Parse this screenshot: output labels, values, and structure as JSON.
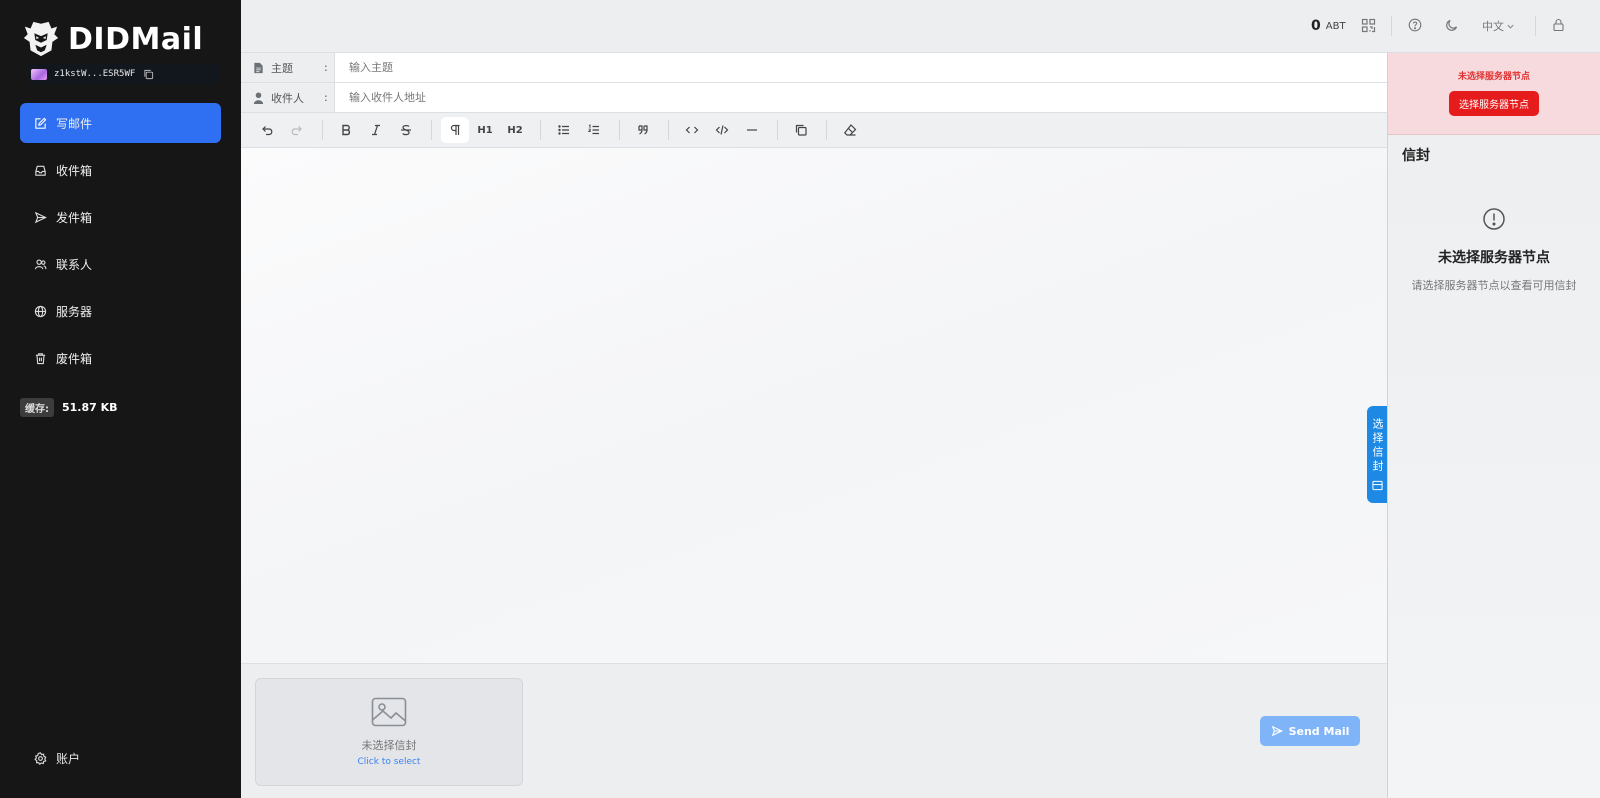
{
  "app": {
    "name": "DIDMail",
    "address": "z1kstW...ESR5WF"
  },
  "sidebar": {
    "items": [
      {
        "label": "写邮件",
        "icon": "edit-icon",
        "active": true
      },
      {
        "label": "收件箱",
        "icon": "inbox-icon"
      },
      {
        "label": "发件箱",
        "icon": "send-icon"
      },
      {
        "label": "联系人",
        "icon": "contacts-icon"
      },
      {
        "label": "服务器",
        "icon": "globe-icon"
      },
      {
        "label": "废件箱",
        "icon": "trash-icon"
      }
    ],
    "cache_label": "缓存:",
    "cache_value": "51.87 KB",
    "account_label": "账户"
  },
  "topbar": {
    "balance": "0",
    "balance_unit": "ABT",
    "language": "中文"
  },
  "compose": {
    "subject_label": "主题",
    "subject_placeholder": "输入主题",
    "recipient_label": "收件人",
    "recipient_placeholder": "输入收件人地址",
    "colon": ":",
    "h1": "H1",
    "h2": "H2"
  },
  "bottom": {
    "envelope_empty": "未选择信封",
    "envelope_action": "Click to select",
    "send_label": "Send Mail"
  },
  "right_panel": {
    "alert_text": "未选择服务器节点",
    "alert_button": "选择服务器节点",
    "title": "信封",
    "empty_title": "未选择服务器节点",
    "empty_desc": "请选择服务器节点以查看可用信封",
    "side_tab": "选择信封"
  },
  "colors": {
    "accent": "#2f6ff1",
    "danger": "#e61b1b",
    "sidebar_bg": "#161616",
    "send": "#7fb4f8"
  }
}
